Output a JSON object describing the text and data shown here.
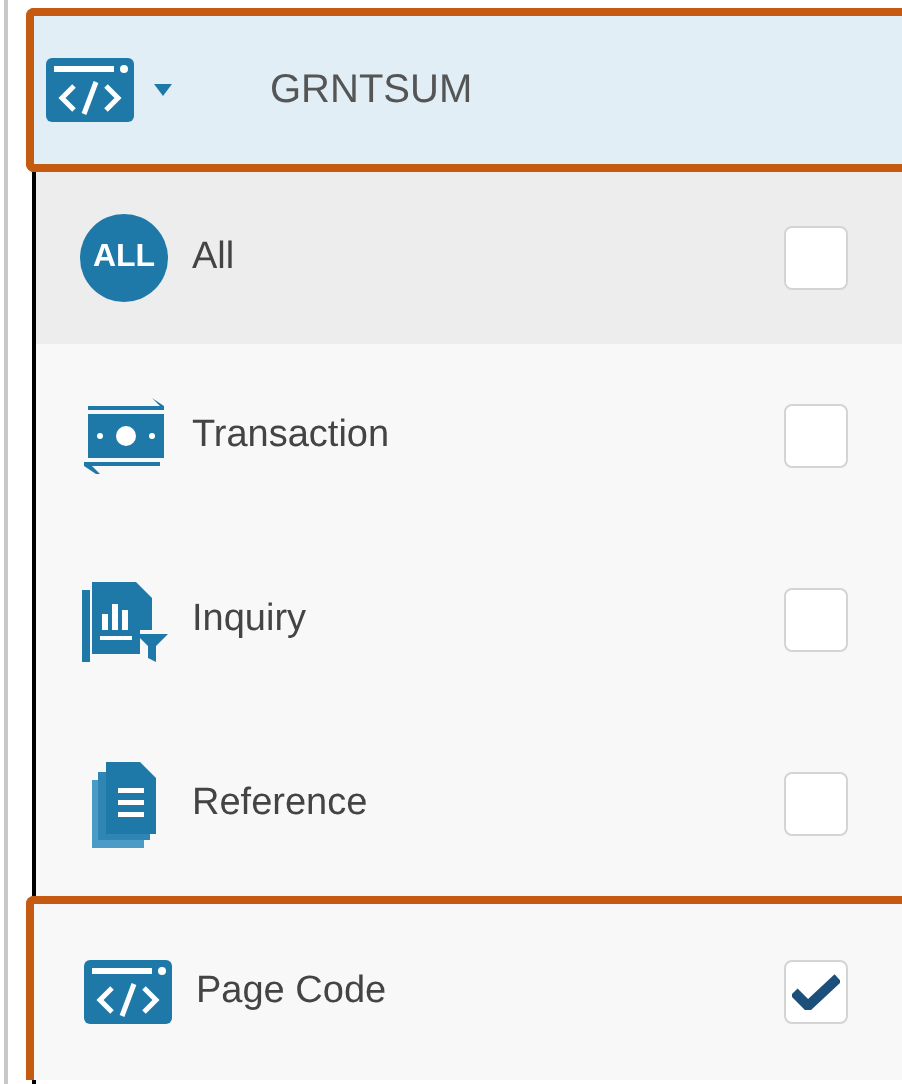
{
  "header": {
    "title": "GRNTSUM",
    "highlighted": true
  },
  "items": [
    {
      "kind": "all",
      "badge": "ALL",
      "label": "All",
      "checked": false,
      "highlighted": false
    },
    {
      "kind": "category",
      "label": "Transaction",
      "checked": false,
      "highlighted": false
    },
    {
      "kind": "category",
      "label": "Inquiry",
      "checked": false,
      "highlighted": false
    },
    {
      "kind": "category",
      "label": "Reference",
      "checked": false,
      "highlighted": false
    },
    {
      "kind": "category",
      "label": "Page Code",
      "checked": true,
      "highlighted": true
    }
  ]
}
